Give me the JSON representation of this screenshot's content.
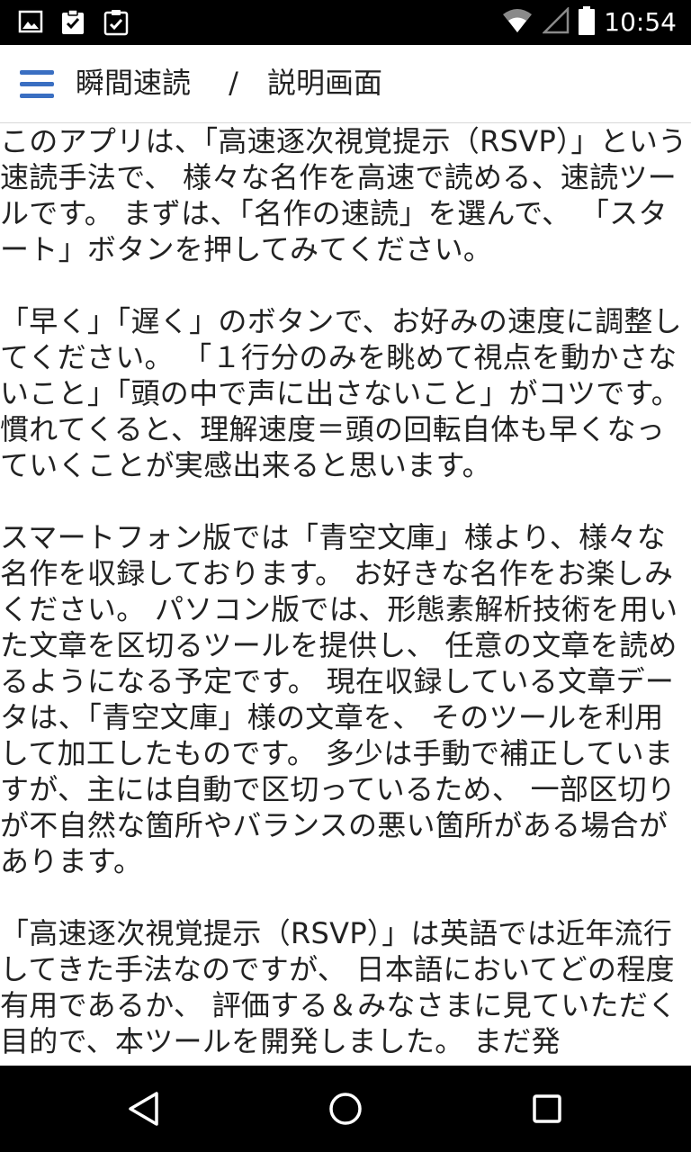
{
  "status_bar": {
    "time": "10:54",
    "icons": [
      "image-icon",
      "clipboard-check-icon",
      "clipboard-check-alt-icon",
      "wifi-icon",
      "signal-icon",
      "battery-icon"
    ]
  },
  "app_bar": {
    "menu_icon": "hamburger-menu-icon",
    "title": "瞬間速読　 /　説明画面",
    "accent_color": "#3a6fc2"
  },
  "content": {
    "paragraphs": [
      "このアプリは、「高速逐次視覚提示（RSVP）」という速読手法で、 様々な名作を高速で読める、速読ツールです。 まずは、「名作の速読」を選んで、 「スタート」ボタンを押してみてください。",
      "「早く」「遅く」のボタンで、お好みの速度に調整してください。 「１行分のみを眺めて視点を動かさないこと」「頭の中で声に出さないこと」がコツです。 慣れてくると、理解速度＝頭の回転自体も早くなっていくことが実感出来ると思います。",
      "スマートフォン版では「青空文庫」様より、様々な名作を収録しております。 お好きな名作をお楽しみください。 パソコン版では、形態素解析技術を用いた文章を区切るツールを提供し、 任意の文章を読めるようになる予定です。 現在収録している文章データは、「青空文庫」様の文章を、 そのツールを利用して加工したものです。 多少は手動で補正していますが、主には自動で区切っているため、 一部区切りが不自然な箇所やバランスの悪い箇所がある場合があります。",
      "「高速逐次視覚提示（RSVP）」は英語では近年流行してきた手法なのですが、 日本語においてどの程度有用であるか、 評価する＆みなさまに見ていただく目的で、本ツールを開発しました。 まだ発"
    ]
  },
  "nav_bar": {
    "icons": [
      "back-triangle-icon",
      "home-circle-icon",
      "recents-square-icon"
    ]
  }
}
